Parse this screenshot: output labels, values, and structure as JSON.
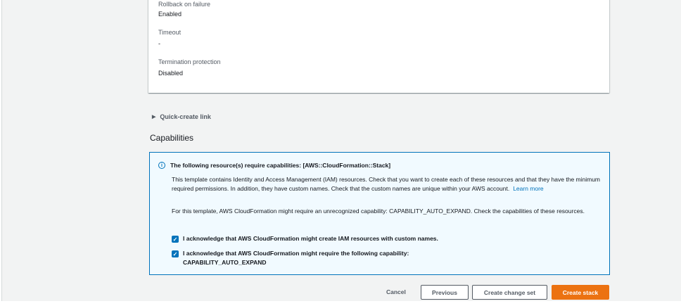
{
  "details": [
    {
      "label": "Rollback on failure",
      "value": "Enabled"
    },
    {
      "label": "Timeout",
      "value": "-"
    },
    {
      "label": "Termination protection",
      "value": "Disabled"
    }
  ],
  "quick_create": "Quick-create link",
  "capabilities": {
    "heading": "Capabilities",
    "alert_title": "The following resource(s) require capabilities: [AWS::CloudFormation::Stack]",
    "para1": "This template contains Identity and Access Management (IAM) resources. Check that you want to create each of these resources and that they have the minimum required permissions. In addition, they have custom names. Check that the custom names are unique within your AWS account.",
    "learn_more": "Learn more",
    "para2": "For this template, AWS CloudFormation might require an unrecognized capability: CAPABILITY_AUTO_EXPAND. Check the capabilities of these resources.",
    "ack1": "I acknowledge that AWS CloudFormation might create IAM resources with custom names.",
    "ack2": "I acknowledge that AWS CloudFormation might require the following capability:",
    "ack2b": "CAPABILITY_AUTO_EXPAND"
  },
  "actions": {
    "cancel": "Cancel",
    "previous": "Previous",
    "change_set": "Create change set",
    "create": "Create stack"
  }
}
